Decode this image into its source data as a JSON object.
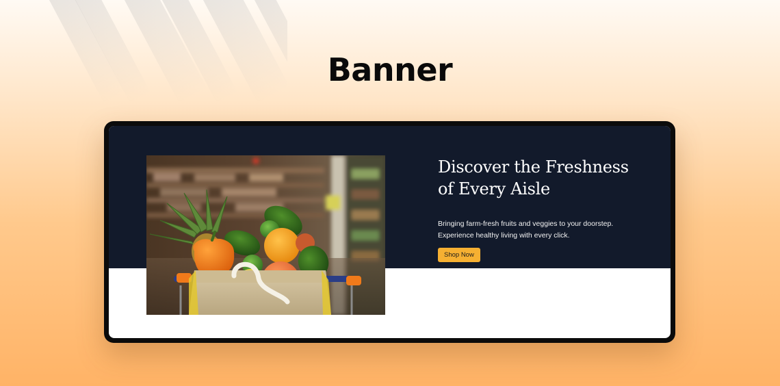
{
  "page": {
    "title": "Banner"
  },
  "hero": {
    "heading_line1": "Discover the Freshness",
    "heading_line2": "of Every Aisle",
    "description_line1": "Bringing farm-fresh fruits and veggies to your doorstep.",
    "description_line2": "Experience healthy living with every click.",
    "button_label": "Shop Now",
    "image": "grocery-bag-with-fruits-and-vegetables"
  },
  "colors": {
    "background_top": "#fffaf4",
    "background_bottom": "#ffb366",
    "device_frame": "#0b0b0b",
    "hero_band": "#121a2b",
    "hero_bottom": "#ffffff",
    "button": "#f6b032",
    "heading_text": "#ffffff",
    "title_text": "#0a0a0a"
  }
}
